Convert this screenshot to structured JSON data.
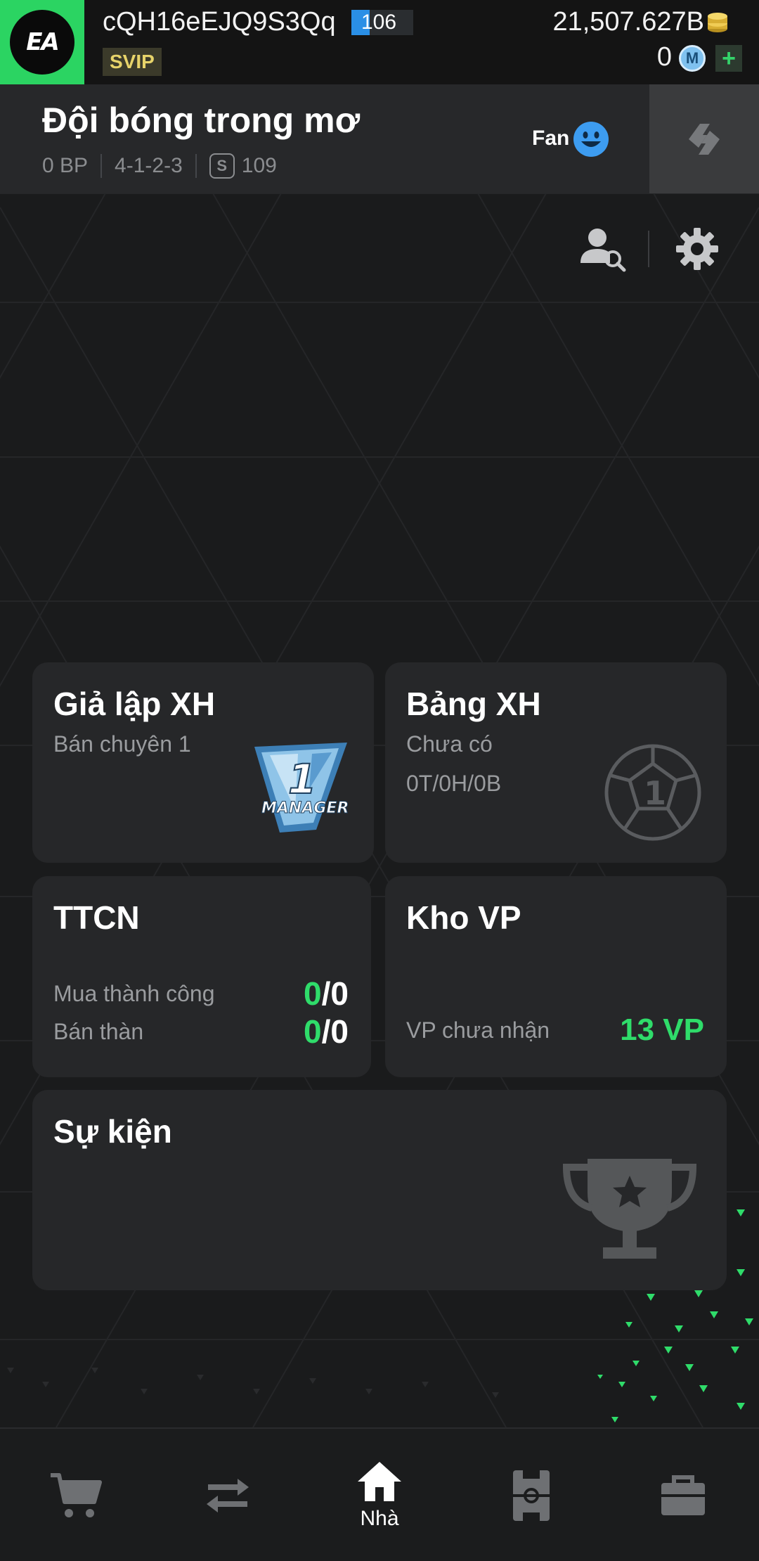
{
  "topbar": {
    "logo_text": "EA",
    "username": "cQH16eEJQ9S3Qq",
    "level": "106",
    "level_progress": 0.3,
    "vip": "SVIP",
    "coins": "21,507.627B",
    "m_points": "0",
    "m_icon_letter": "M",
    "plus": "+"
  },
  "team": {
    "name": "Đội bóng trong mơ",
    "bp": "0 BP",
    "formation": "4-1-2-3",
    "s_letter": "S",
    "salary": "109",
    "fan_label": "Fan"
  },
  "cards": {
    "simulation": {
      "title": "Giả lập XH",
      "sub": "Bán chuyên 1",
      "badge_number": "1",
      "badge_text": "MANAGER"
    },
    "ranking": {
      "title": "Bảng XH",
      "sub": "Chưa có",
      "record": "0T/0H/0B",
      "ball_number": "1"
    },
    "ttcn": {
      "title": "TTCN",
      "buy_label": "Mua thành công",
      "buy_done": "0",
      "buy_total": "/0",
      "sell_label": "Bán thàn",
      "sell_done": "0",
      "sell_total": "/0"
    },
    "kho_vp": {
      "title": "Kho VP",
      "unclaimed_label": "VP chưa nhận",
      "unclaimed_value": "13 VP"
    },
    "events": {
      "title": "Sự kiện"
    }
  },
  "nav": {
    "items": [
      {
        "icon": "cart-icon",
        "label": ""
      },
      {
        "icon": "transfer-icon",
        "label": ""
      },
      {
        "icon": "home-icon",
        "label": "Nhà"
      },
      {
        "icon": "pitch-icon",
        "label": ""
      },
      {
        "icon": "bag-icon",
        "label": ""
      }
    ]
  },
  "colors": {
    "accent_green": "#2fdc6a",
    "level_blue": "#2a8fe6",
    "background": "#1a1b1c",
    "card": "#262729"
  }
}
